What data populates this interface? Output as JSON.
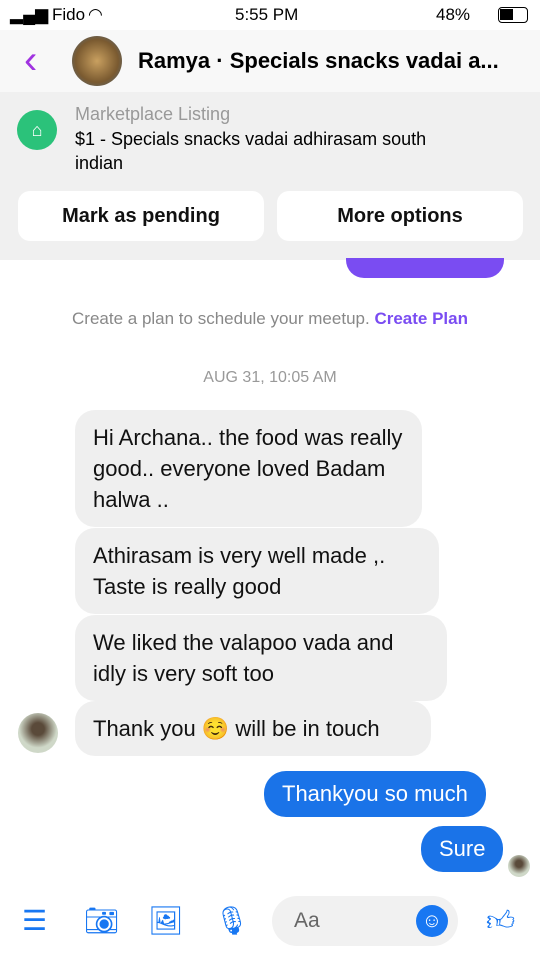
{
  "status": {
    "carrier": "Fido",
    "time": "5:55 PM",
    "battery": "48%"
  },
  "header": {
    "title": "Ramya · Specials snacks vadai a..."
  },
  "listing": {
    "label": "Marketplace Listing",
    "title": "$1 - Specials snacks vadai adhirasam south indian",
    "mark_pending": "Mark as pending",
    "more_options": "More options"
  },
  "plan": {
    "text": "Create a plan to schedule your meetup.",
    "link": "Create Plan"
  },
  "date": "AUG 31, 10:05 AM",
  "messages": [
    {
      "from": "them",
      "text": "Hi Archana.. the food was really good.. everyone loved Badam halwa .."
    },
    {
      "from": "them",
      "text": "Athirasam is very well made ,. Taste is really good"
    },
    {
      "from": "them",
      "text": "We liked the valapoo vada and idly is very soft too"
    },
    {
      "from": "them",
      "text": "Thank you ☺️ will be in touch"
    },
    {
      "from": "me",
      "text": "Thankyou so much"
    },
    {
      "from": "me",
      "text": "Sure"
    }
  ],
  "composer": {
    "placeholder": "Aa"
  }
}
